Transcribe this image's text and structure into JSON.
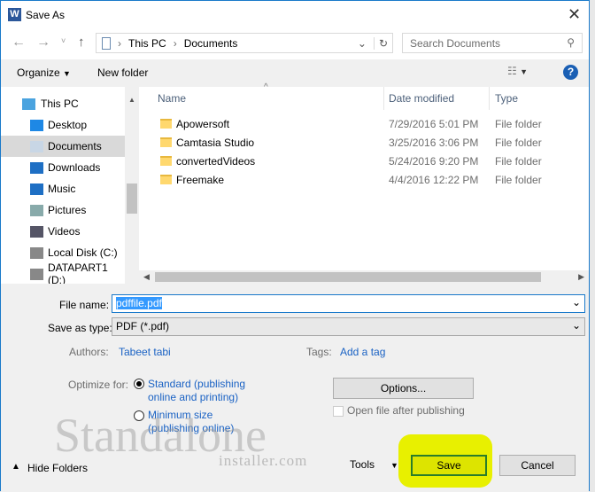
{
  "window": {
    "title": "Save As",
    "app_icon": "word-icon"
  },
  "nav": {
    "path": [
      "This PC",
      "Documents"
    ],
    "search_placeholder": "Search Documents"
  },
  "toolbar": {
    "organize": "Organize",
    "new_folder": "New folder"
  },
  "sidebar": {
    "items": [
      {
        "label": "This PC",
        "icon": "computer-icon"
      },
      {
        "label": "Desktop",
        "icon": "desktop-icon"
      },
      {
        "label": "Documents",
        "icon": "documents-icon",
        "selected": true
      },
      {
        "label": "Downloads",
        "icon": "downloads-icon"
      },
      {
        "label": "Music",
        "icon": "music-icon"
      },
      {
        "label": "Pictures",
        "icon": "pictures-icon"
      },
      {
        "label": "Videos",
        "icon": "videos-icon"
      },
      {
        "label": "Local Disk (C:)",
        "icon": "drive-icon"
      },
      {
        "label": "DATAPART1 (D:)",
        "icon": "drive-icon"
      }
    ]
  },
  "columns": {
    "name": "Name",
    "date": "Date modified",
    "type": "Type"
  },
  "files": [
    {
      "name": "Apowersoft",
      "date": "7/29/2016 5:01 PM",
      "type": "File folder"
    },
    {
      "name": "Camtasia Studio",
      "date": "3/25/2016 3:06 PM",
      "type": "File folder"
    },
    {
      "name": "convertedVideos",
      "date": "5/24/2016 9:20 PM",
      "type": "File folder"
    },
    {
      "name": "Freemake",
      "date": "4/4/2016 12:22 PM",
      "type": "File folder"
    }
  ],
  "form": {
    "file_name_label": "File name:",
    "file_name": "pdffile.pdf",
    "type_label": "Save as type:",
    "type_value": "PDF (*.pdf)",
    "authors_label": "Authors:",
    "authors": "Tabeet tabi",
    "tags_label": "Tags:",
    "tags": "Add a tag",
    "optimize_label": "Optimize for:",
    "opt1_a": "Standard (publishing",
    "opt1_b": "online and printing)",
    "opt2_a": "Minimum size",
    "opt2_b": "(publishing online)",
    "options": "Options...",
    "open_after": "Open file after publishing"
  },
  "footer": {
    "hide_folders": "Hide Folders",
    "tools": "Tools",
    "save": "Save",
    "cancel": "Cancel"
  },
  "watermark": {
    "line1": "Standalone",
    "line2": "installer.com"
  },
  "colors": {
    "accent": "#1979ca",
    "highlight": "#e8f000",
    "link": "#1a62c4"
  }
}
